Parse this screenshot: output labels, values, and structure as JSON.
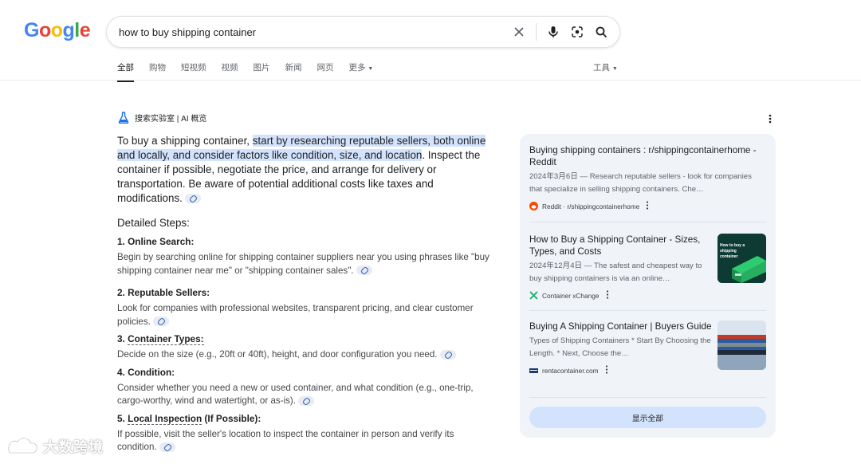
{
  "logo": {
    "g1": "G",
    "o1": "o",
    "o2": "o",
    "g2": "g",
    "l": "l",
    "e": "e"
  },
  "search": {
    "query": "how to buy shipping container"
  },
  "tabs": [
    {
      "label": "全部",
      "active": true
    },
    {
      "label": "购物"
    },
    {
      "label": "短视频"
    },
    {
      "label": "视频"
    },
    {
      "label": "图片"
    },
    {
      "label": "新闻"
    },
    {
      "label": "网页"
    },
    {
      "label": "更多"
    }
  ],
  "tools": {
    "label": "工具"
  },
  "ai": {
    "header": "搜索实验室 | AI 概览",
    "summary_pre": "To buy a shipping container, ",
    "summary_hl": "start by researching reputable sellers, both online and locally, and consider factors like condition, size, and location",
    "summary_post": ". Inspect the container if possible, negotiate the price, and arrange for delivery or transportation. Be aware of potential additional costs like taxes and modifications.",
    "steps_title": "Detailed Steps:",
    "steps": [
      {
        "num": "1. ",
        "title": "Online Search:",
        "title_suffix": "",
        "body": "Begin by searching online for shipping container suppliers near you using phrases like \"buy shipping container near me\" or \"shipping container sales\"."
      },
      {
        "num": "2. ",
        "title": "Reputable Sellers:",
        "title_suffix": "",
        "body": "Look for companies with professional websites, transparent pricing, and clear customer policies."
      },
      {
        "num": "3. ",
        "title": "Container Types:",
        "title_suffix": "",
        "body": "Decide on the size (e.g., 20ft or 40ft), height, and door configuration you need."
      },
      {
        "num": "4. ",
        "title": "Condition:",
        "title_suffix": "",
        "body": "Consider whether you need a new or used container, and what condition (e.g., one-trip, cargo-worthy, wind and watertight, or as-is)."
      },
      {
        "num": "5. ",
        "title": "Local Inspection",
        "title_suffix": " (If Possible):",
        "body": "If possible, visit the seller's location to inspect the container in person and verify its condition."
      }
    ]
  },
  "sources": [
    {
      "title": "Buying shipping containers : r/shippingcontainerhome - Reddit",
      "snippet": "2024年3月6日 — Research reputable sellers - look for companies that specialize in selling shipping containers. Che…",
      "source": "Reddit · r/shippingcontainerhome",
      "icon_color": "#ff4500"
    },
    {
      "title": "How to Buy a Shipping Container - Sizes, Types, and Costs",
      "snippet": "2024年12月4日 — The safest and cheapest way to buy shipping containers is via an online…",
      "source": "Container xChange",
      "icon_color": "#2bb673",
      "thumb_text": "How to buy a shipping container"
    },
    {
      "title": "Buying A Shipping Container | Buyers Guide",
      "snippet": "Types of Shipping Containers * Start By Choosing the Length. * Next, Choose the…",
      "source": "rentacontainer.com",
      "icon_color": "#1a3c6e"
    }
  ],
  "show_all": "显示全部",
  "watermark": "大数跨境"
}
